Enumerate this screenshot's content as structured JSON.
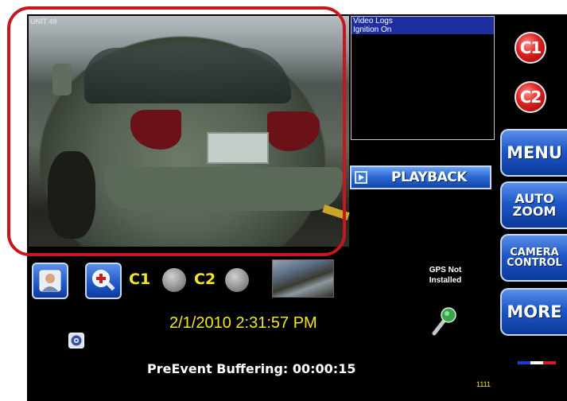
{
  "log_panel": {
    "items": [
      "Video Logs",
      "Ignition On"
    ]
  },
  "camera_buttons": {
    "c1": "C1",
    "c2": "C2"
  },
  "side_menu": {
    "menu": "MENU",
    "auto_zoom_line1": "AUTO",
    "auto_zoom_line2": "ZOOM",
    "camera_control_line1": "CAMERA",
    "camera_control_line2": "CONTROL",
    "more": "MORE"
  },
  "playback": {
    "label": "PLAYBACK"
  },
  "camera_selectors": {
    "c1": "C1",
    "c2": "C2"
  },
  "gps": {
    "line1": "GPS Not",
    "line2": "Installed"
  },
  "status": {
    "datetime": "2/1/2010 2:31:57 PM",
    "buffering": "PreEvent Buffering: 00:00:15",
    "counter": "1111"
  },
  "video": {
    "overlay_text": "UNIT 49"
  },
  "icons": {
    "user": "user-icon",
    "zoom": "zoom-icon",
    "gps_marker": "gps-target-icon",
    "microphone": "microphone-icon",
    "playback": "play-icon"
  },
  "colors": {
    "accent_blue": "#1e57c8",
    "alert_red": "#e02020",
    "highlight": "#c8161e",
    "text_yellow": "#f4e81c"
  }
}
